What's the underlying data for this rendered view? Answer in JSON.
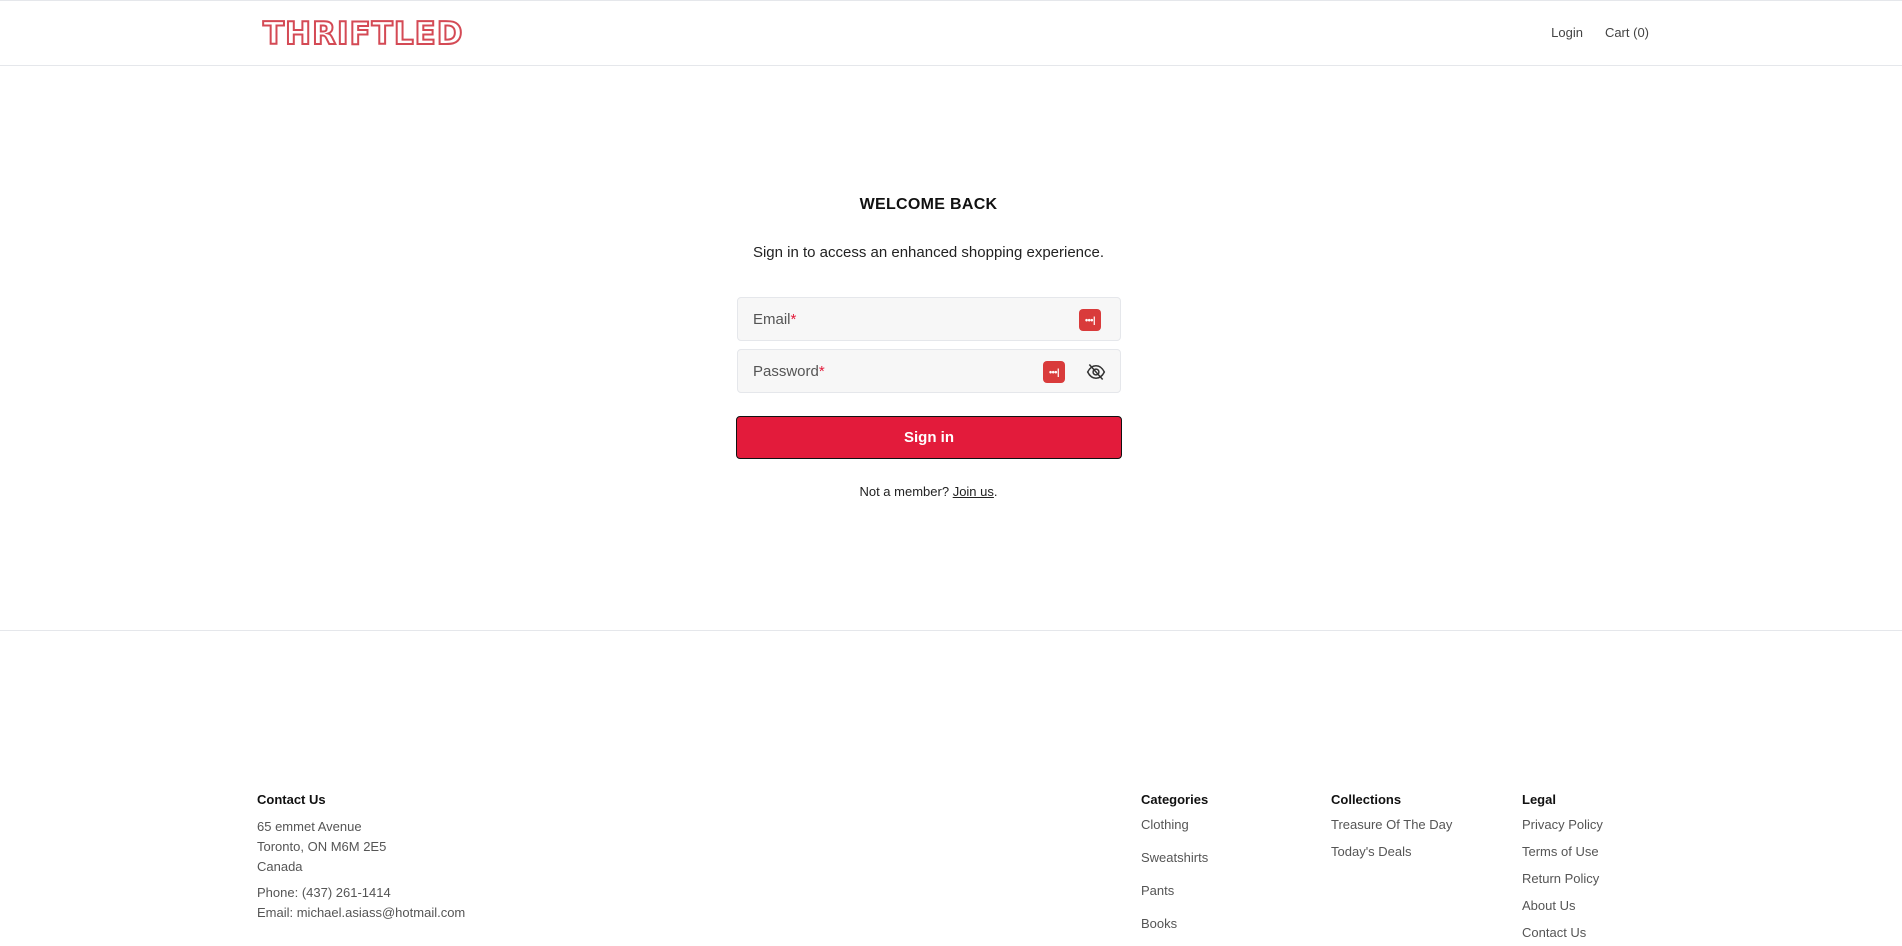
{
  "header": {
    "logo": "THRIFTLED",
    "nav": {
      "login": "Login",
      "cart": "Cart (0)"
    }
  },
  "login": {
    "title": "WELCOME BACK",
    "subtitle": "Sign in to access an enhanced shopping experience.",
    "email_label": "Email",
    "password_label": "Password",
    "required_mark": "*",
    "sign_in_label": "Sign in",
    "member_text": "Not a member?",
    "join_label": "Join us",
    "period": "."
  },
  "footer": {
    "contact": {
      "heading": "Contact Us",
      "address_1": "65 emmet Avenue",
      "address_2": "Toronto, ON M6M 2E5",
      "address_3": "Canada",
      "phone": "Phone: (437) 261-1414",
      "email": "Email: michael.asiass@hotmail.com"
    },
    "categories": {
      "heading": "Categories",
      "items": [
        "Clothing",
        "Sweatshirts",
        "Pants",
        "Books"
      ]
    },
    "collections": {
      "heading": "Collections",
      "items": [
        "Treasure Of The Day",
        "Today's Deals"
      ]
    },
    "legal": {
      "heading": "Legal",
      "items": [
        "Privacy Policy",
        "Terms of Use",
        "Return Policy",
        "About Us",
        "Contact Us"
      ]
    }
  },
  "colors": {
    "brand": "#e31b3b",
    "logo_stroke": "#d44a55",
    "password_manager": "#d93b3b"
  },
  "icons": {
    "email_pm": "password-manager-icon",
    "password_pm": "password-manager-icon",
    "toggle": "eye-off-icon"
  }
}
